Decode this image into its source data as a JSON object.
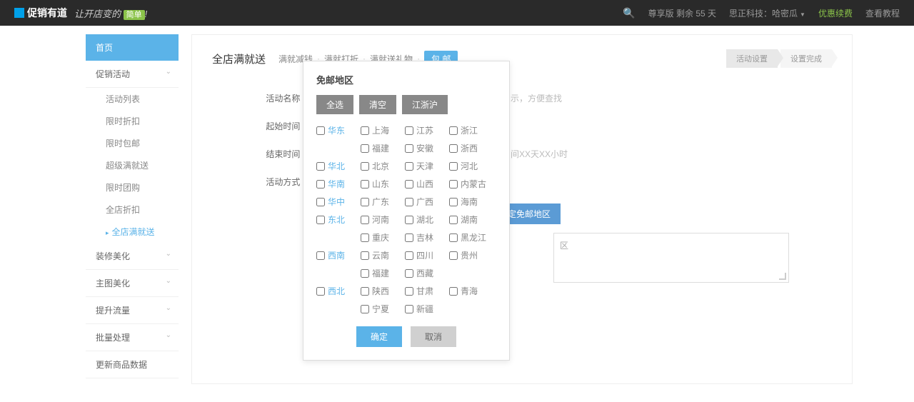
{
  "topbar": {
    "logo": "促销有道",
    "tagline_prefix": "让开店变的",
    "tagline_badge": "简单",
    "tagline_suffix": "!",
    "version": "尊享版 剩余 55 天",
    "company": "思正科技：哈密瓜",
    "renew": "优惠续费",
    "tutorial": "查看教程"
  },
  "sidebar": {
    "home": "首页",
    "promo": "促销活动",
    "promo_items": [
      "活动列表",
      "限时折扣",
      "限时包邮",
      "超级满就送",
      "限时团购",
      "全店折扣",
      "全店满就送"
    ],
    "others": [
      "装修美化",
      "主图美化",
      "提升流量",
      "批量处理",
      "更新商品数据"
    ]
  },
  "page": {
    "title": "全店满就送",
    "tabs": [
      "满就减钱",
      "满就打折",
      "满就送礼物",
      "包 邮"
    ],
    "steps": [
      "活动设置",
      "设置完成"
    ]
  },
  "form": {
    "name_label": "活动名称 :",
    "name_hint": "示，方便查找",
    "start_label": "起始时间 :",
    "end_label": "结束时间 :",
    "end_hint": "间XX天XX小时",
    "method_label": "活动方式 :",
    "region_btn": "定免邮地区",
    "region_placeholder": "区"
  },
  "modal": {
    "title": "免邮地区",
    "btn_all": "全选",
    "btn_clear": "清空",
    "btn_jzs": "江浙沪",
    "confirm": "确定",
    "cancel": "取消",
    "grid": [
      {
        "label": "华东",
        "group": true
      },
      {
        "label": "上海"
      },
      {
        "label": "江苏"
      },
      {
        "label": "浙江"
      },
      {
        "label": ""
      },
      {
        "label": "福建"
      },
      {
        "label": "安徽"
      },
      {
        "label": "浙西"
      },
      {
        "label": "华北",
        "group": true
      },
      {
        "label": "北京"
      },
      {
        "label": "天津"
      },
      {
        "label": "河北"
      },
      {
        "label": "华南",
        "group": true
      },
      {
        "label": "山东"
      },
      {
        "label": "山西"
      },
      {
        "label": "内蒙古"
      },
      {
        "label": "华中",
        "group": true
      },
      {
        "label": "广东"
      },
      {
        "label": "广西"
      },
      {
        "label": "海南"
      },
      {
        "label": "东北",
        "group": true
      },
      {
        "label": "河南"
      },
      {
        "label": "湖北"
      },
      {
        "label": "湖南"
      },
      {
        "label": ""
      },
      {
        "label": "重庆"
      },
      {
        "label": "吉林"
      },
      {
        "label": "黑龙江"
      },
      {
        "label": "西南",
        "group": true
      },
      {
        "label": "云南"
      },
      {
        "label": "四川"
      },
      {
        "label": "贵州"
      },
      {
        "label": ""
      },
      {
        "label": "福建"
      },
      {
        "label": "西藏"
      },
      {
        "label": ""
      },
      {
        "label": "西北",
        "group": true
      },
      {
        "label": "陕西"
      },
      {
        "label": "甘肃"
      },
      {
        "label": "青海"
      },
      {
        "label": ""
      },
      {
        "label": "宁夏"
      },
      {
        "label": "新疆"
      },
      {
        "label": ""
      }
    ]
  }
}
